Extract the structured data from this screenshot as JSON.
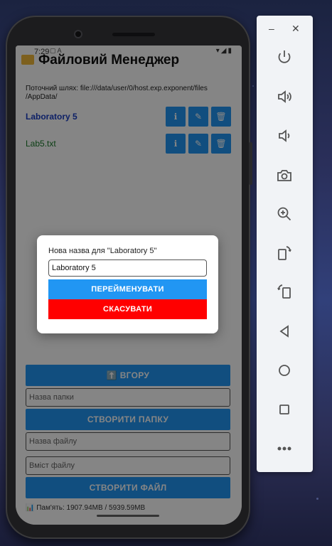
{
  "status": {
    "time": "7:29",
    "icons_left": "▢ A",
    "icons_right": "▾◢▮"
  },
  "app": {
    "title": "Файловий Менеджер"
  },
  "path": "Поточний шлях: file:///data/user/0/host.exp.exponent/files /AppData/",
  "files": [
    {
      "name": "Laboratory 5",
      "kind": "folder"
    },
    {
      "name": "Lab5.txt",
      "kind": "file"
    }
  ],
  "row_icons": {
    "info": "ℹ",
    "edit": "✎",
    "delete": "🗑"
  },
  "controls": {
    "up_button": "⬆️ ВГОРУ",
    "folder_placeholder": "Назва папки",
    "create_folder": "СТВОРИТИ ПАПКУ",
    "file_placeholder": "Назва файлу",
    "content_placeholder": "Вміст файлу",
    "create_file": "СТВОРИТИ ФАЙЛ",
    "memory": "📊 Пам'ять: 1907.94MB / 5939.59MB"
  },
  "dialog": {
    "label": "Нова назва для \"Laboratory 5\"",
    "input_value": "Laboratory 5",
    "rename": "ПЕРЕЙМЕНУВАТИ",
    "cancel": "СКАСУВАТИ"
  },
  "panel": {
    "minimize": "–",
    "close": "✕",
    "buttons": [
      "power-icon",
      "volume-up-icon",
      "volume-down-icon",
      "camera-icon",
      "zoom-in-icon",
      "rotate-right-icon",
      "rotate-left-icon",
      "back-icon",
      "home-icon",
      "overview-icon",
      "more-icon"
    ]
  },
  "colors": {
    "primary": "#2196f3",
    "danger": "#ff0000",
    "folder_text": "#1a3ec4",
    "file_text": "#1a7a2a"
  }
}
